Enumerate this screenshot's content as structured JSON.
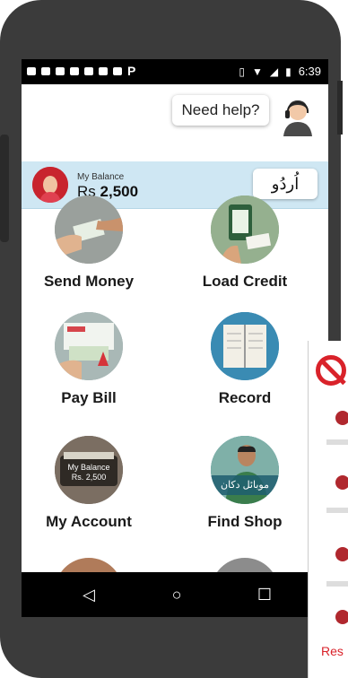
{
  "status_bar": {
    "time": "6:39"
  },
  "help": {
    "label": "Need help?"
  },
  "balance": {
    "label": "My Balance",
    "currency": "Rs",
    "amount": "2,500"
  },
  "language_button": {
    "label": "اُردُو"
  },
  "tiles": [
    {
      "label": "Send Money",
      "icon": "send-money-icon",
      "color": "#8a8f8c"
    },
    {
      "label": "Load Credit",
      "icon": "load-credit-icon",
      "color": "#7aa37a"
    },
    {
      "label": "Pay Bill",
      "icon": "pay-bill-icon",
      "color": "#8da2a6"
    },
    {
      "label": "Record",
      "icon": "record-icon",
      "color": "#2f7fa8"
    },
    {
      "label": "My Account",
      "icon": "my-account-icon",
      "color": "#6c6258"
    },
    {
      "label": "Find Shop",
      "icon": "find-shop-icon",
      "color": "#2c7f8a"
    }
  ],
  "account_tile_overlay": {
    "line1": "My Balance",
    "line2": "Rs. 2,500"
  },
  "find_shop_overlay": {
    "text": "موبائل دکان"
  },
  "overlay_panel": {
    "text": "Res"
  },
  "colors": {
    "balance_bar": "#cfe7f3",
    "phone_body": "#3b3b3b",
    "accent_red": "#d9222a"
  }
}
